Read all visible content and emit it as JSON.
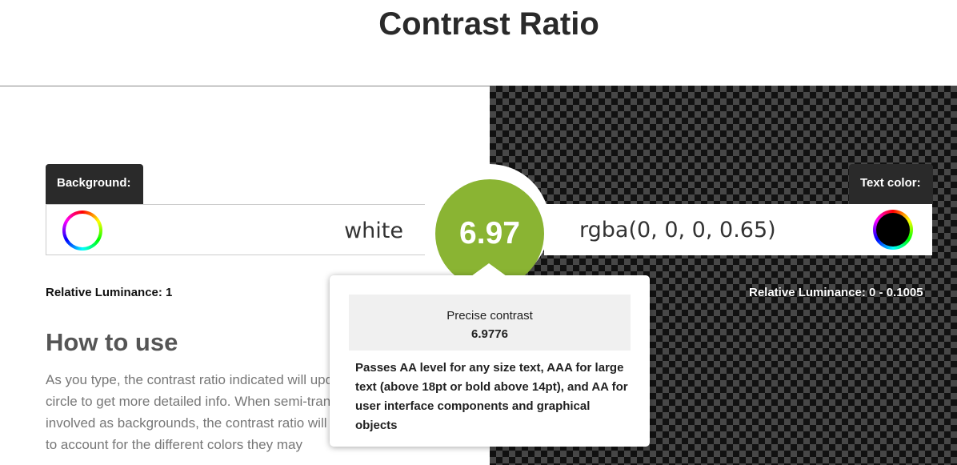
{
  "page": {
    "title": "Contrast Ratio"
  },
  "background": {
    "label": "Background:",
    "value": "white",
    "luminance": "Relative Luminance: 1",
    "swatch_color": "#ffffff"
  },
  "text_color": {
    "label": "Text color:",
    "value": "rgba(0, 0, 0, 0.65)",
    "luminance": "Relative Luminance: 0 - 0.1005",
    "swatch_color": "#000000"
  },
  "result": {
    "ratio": "6.97",
    "color": "#8ab433"
  },
  "tooltip": {
    "precise_label": "Precise contrast",
    "precise_value": "6.9776",
    "verdict": "Passes AA level for any size text, AAA for large text (above 18pt or bold above 14pt), and AA for user interface components and graphical objects"
  },
  "howto": {
    "heading": "How to use",
    "text": "As you type, the contrast ratio indicated will update. Hover over the circle to get more detailed info. When semi-transparent colors are involved as backgrounds, the contrast ratio will have an error margin, to account for the different colors they may"
  }
}
